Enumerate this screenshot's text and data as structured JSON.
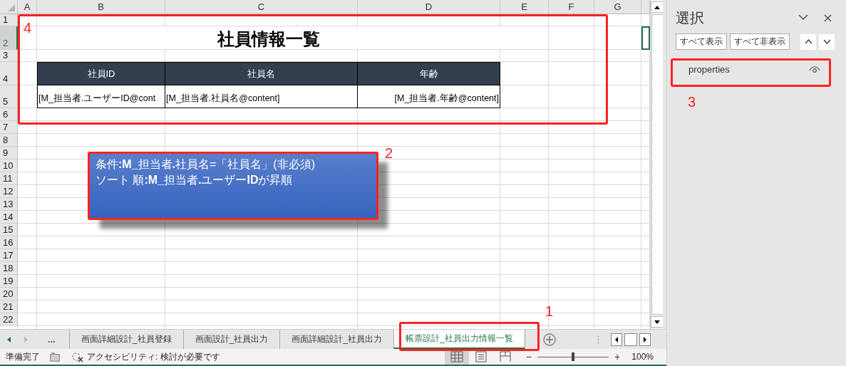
{
  "columns": [
    "A",
    "B",
    "C",
    "D",
    "E",
    "F",
    "G"
  ],
  "rows": [
    {
      "label": "1",
      "selected": false
    },
    {
      "label": "2",
      "selected": true
    },
    {
      "label": "3",
      "selected": false
    },
    {
      "label": "4",
      "selected": false
    },
    {
      "label": "5",
      "selected": false
    },
    {
      "label": "6",
      "selected": false
    },
    {
      "label": "7",
      "selected": false
    },
    {
      "label": "8",
      "selected": false
    },
    {
      "label": "9",
      "selected": false
    },
    {
      "label": "10",
      "selected": false
    },
    {
      "label": "11",
      "selected": false
    },
    {
      "label": "12",
      "selected": false
    },
    {
      "label": "13",
      "selected": false
    },
    {
      "label": "14",
      "selected": false
    },
    {
      "label": "15",
      "selected": false
    },
    {
      "label": "16",
      "selected": false
    },
    {
      "label": "17",
      "selected": false
    },
    {
      "label": "18",
      "selected": false
    },
    {
      "label": "19",
      "selected": false
    },
    {
      "label": "20",
      "selected": false
    },
    {
      "label": "21",
      "selected": false
    },
    {
      "label": "22",
      "selected": false
    }
  ],
  "sheet": {
    "title": "社員情報一覧",
    "table_headers": [
      "社員ID",
      "社員名",
      "年齢"
    ],
    "table_row": [
      "[M_担当者.ユーザーID@cont",
      "[M_担当者.社員名@content]",
      "[M_担当者.年齢@content]"
    ]
  },
  "shape": {
    "lines": [
      "条件**:M_**担当者**.**社員名=「社員名」(非必須)",
      "ソート 順**:M_**担当者**.**ユーザー**ID**が昇順"
    ]
  },
  "annotations": [
    "4",
    "2",
    "3",
    "1"
  ],
  "selection_pane": {
    "title": "選択",
    "buttons": [
      "すべて表示",
      "すべて非表示"
    ],
    "items": [
      {
        "name": "properties",
        "visible": true
      }
    ]
  },
  "tab_overflow": "...",
  "sheet_tabs": [
    {
      "label": "画面詳細設計_社員登録",
      "selected": false
    },
    {
      "label": "画面設計_社員出力",
      "selected": false
    },
    {
      "label": "画面詳細設計_社員出力",
      "selected": false
    },
    {
      "label": "帳票設計_社員出力情報一覧",
      "selected": true
    }
  ],
  "status_bar": {
    "status": "準備完了",
    "accessibility": "アクセシビリティ: 検討が必要です",
    "views": [
      {
        "kind": "normal",
        "selected": true
      },
      {
        "kind": "page-layout",
        "selected": false
      },
      {
        "kind": "page-break",
        "selected": false
      }
    ],
    "zoom_out": "−",
    "zoom_slider": {
      "level": 0.5
    },
    "zoom_in": "+",
    "zoom": "100%"
  }
}
